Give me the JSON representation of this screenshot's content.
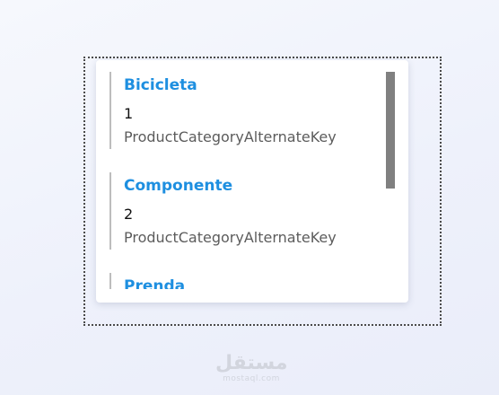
{
  "list": {
    "items": [
      {
        "title": "Bicicleta",
        "value": "1",
        "key": "ProductCategoryAlternateKey"
      },
      {
        "title": "Componente",
        "value": "2",
        "key": "ProductCategoryAlternateKey"
      },
      {
        "title": "Prenda",
        "value": "",
        "key": ""
      }
    ]
  },
  "watermark": {
    "main": "مستقل",
    "sub": "mostaql.com"
  },
  "colors": {
    "title": "#1e8fe0",
    "scrollbar": "#808080",
    "item_border": "#bdbdbd"
  }
}
